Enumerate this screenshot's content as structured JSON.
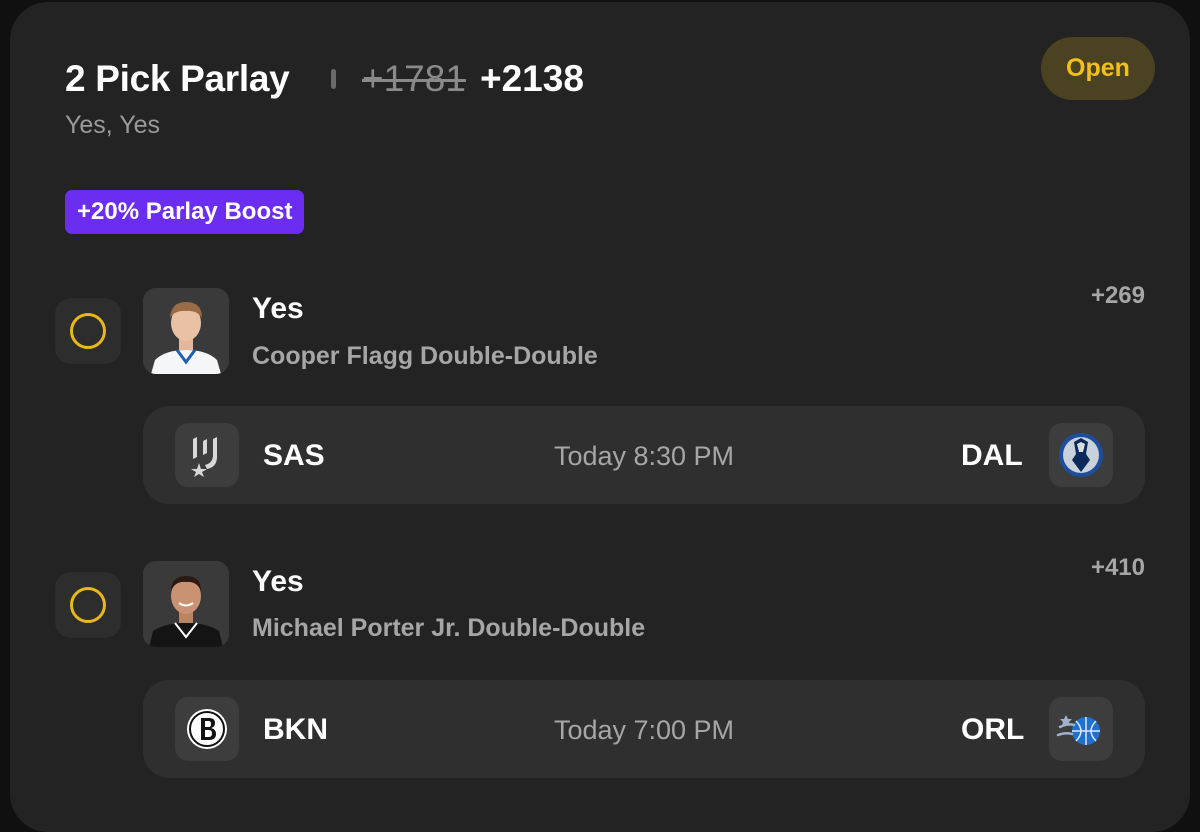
{
  "header": {
    "title": "2 Pick Parlay",
    "old_odds": "+1781",
    "new_odds": "+2138",
    "subtitle": "Yes, Yes",
    "status": "Open",
    "boost": "+20% Parlay Boost"
  },
  "colors": {
    "card_bg": "#232323",
    "status_text": "#f2c01a",
    "status_bg": "#4a4220",
    "boost_bg": "#6b2df0",
    "pending_ring": "#e7b81d"
  },
  "picks": [
    {
      "label": "Yes",
      "market": "Cooper Flagg Double-Double",
      "odds": "+269",
      "player_jersey_color": "#ffffff",
      "game": {
        "away_team": "SAS",
        "away_icon": "spurs-logo-icon",
        "time": "Today 8:30 PM",
        "home_team": "DAL",
        "home_icon": "mavericks-logo-icon"
      }
    },
    {
      "label": "Yes",
      "market": "Michael Porter Jr. Double-Double",
      "odds": "+410",
      "player_jersey_color": "#111111",
      "game": {
        "away_team": "BKN",
        "away_icon": "nets-logo-icon",
        "time": "Today 7:00 PM",
        "home_team": "ORL",
        "home_icon": "magic-logo-icon"
      }
    }
  ]
}
